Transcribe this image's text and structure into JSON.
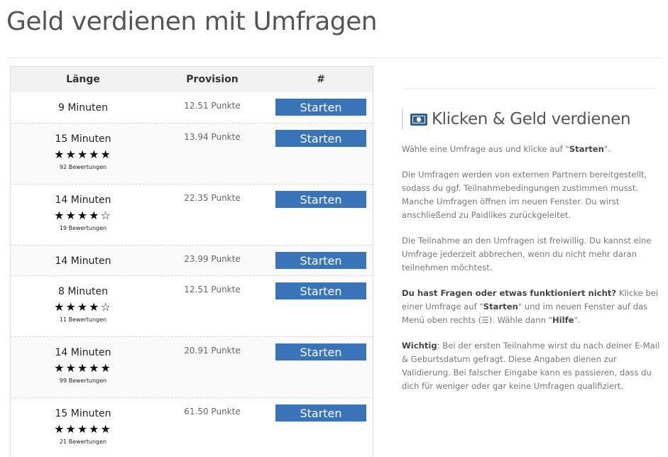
{
  "page": {
    "title": "Geld verdienen mit Umfragen"
  },
  "table": {
    "headers": {
      "length": "Länge",
      "commission": "Provision",
      "action": "#"
    },
    "rows": [
      {
        "duration": "9 Minuten",
        "points": "12.51 Punkte",
        "button": "Starten",
        "stars": null,
        "rating_count": null
      },
      {
        "duration": "15 Minuten",
        "points": "13.94 Punkte",
        "button": "Starten",
        "stars": "★★★★★",
        "rating_count": "92 Bewertungen"
      },
      {
        "duration": "14 Minuten",
        "points": "22.35 Punkte",
        "button": "Starten",
        "stars": "★★★★☆",
        "rating_count": "19 Bewertungen"
      },
      {
        "duration": "14 Minuten",
        "points": "23.99 Punkte",
        "button": "Starten",
        "stars": null,
        "rating_count": null
      },
      {
        "duration": "8 Minuten",
        "points": "12.51 Punkte",
        "button": "Starten",
        "stars": "★★★★☆",
        "rating_count": "11 Bewertungen"
      },
      {
        "duration": "14 Minuten",
        "points": "20.91 Punkte",
        "button": "Starten",
        "stars": "★★★★★",
        "rating_count": "99 Bewertungen"
      },
      {
        "duration": "15 Minuten",
        "points": "61.50 Punkte",
        "button": "Starten",
        "stars": "★★★★★",
        "rating_count": "21 Bewertungen"
      }
    ]
  },
  "sidebar": {
    "heading_icon": "money-bill-icon",
    "heading": "Klicken & Geld verdienen",
    "p1_a": "Wähle eine Umfrage aus und klicke auf \"",
    "p1_b": "Starten",
    "p1_c": "\".",
    "p2": "Die Umfragen werden von externen Partnern bereitgestellt, sodass du ggf. Teilnahmebedingungen zustimmen musst. Manche Umfragen öffnen im neuen Fenster. Du wirst anschließend zu Paidlikes zurückgeleitet.",
    "p3": "Die Teilnahme an den Umfragen ist freiwillig. Du kannst eine Umfrage jederzeit abbrechen, wenn du nicht mehr daran teilnehmen möchtest.",
    "p4_a": "Du hast Fragen oder etwas funktioniert nicht?",
    "p4_b": " Klicke bei einer Umfrage auf \"",
    "p4_c": "Starten",
    "p4_d": "\" und im neuen Fenster auf das Menü oben rechts (☰). Wähle dann \"",
    "p4_e": "Hilfe",
    "p4_f": "\".",
    "p5_a": "Wichtig",
    "p5_b": ": Bei der ersten Teilnahme wirst du nach deiner E-Mail & Geburtsdatum gefragt. Diese Angaben dienen zur Validierung. Bei falscher Eingabe kann es passieren, dass du dich für weniger oder gar keine Umfragen qualifiziert."
  },
  "colors": {
    "button": "#3a74b8",
    "icon": "#2f5f95"
  }
}
